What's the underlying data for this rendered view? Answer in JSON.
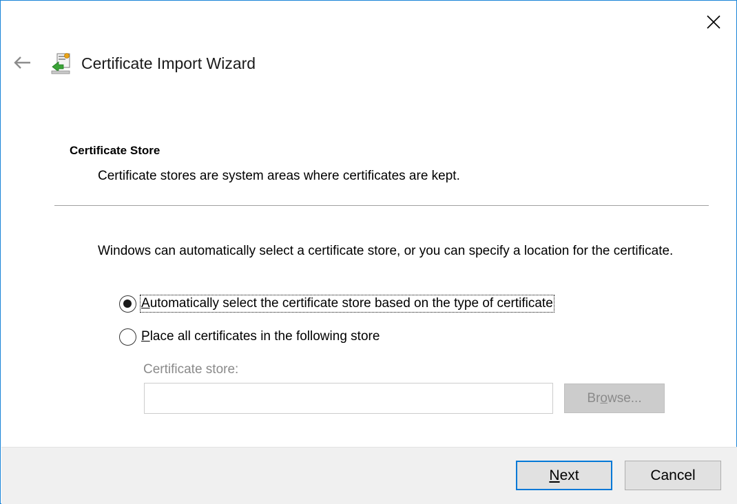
{
  "window": {
    "title": "Certificate Import Wizard",
    "accent_color": "#1883d7",
    "close_icon": "close-icon",
    "back_icon": "back-arrow-icon",
    "app_icon": "certificate-wizard-icon"
  },
  "header": {
    "section_title": "Certificate Store",
    "section_description": "Certificate stores are system areas where certificates are kept."
  },
  "body": {
    "intro": "Windows can automatically select a certificate store, or you can specify a location for the certificate.",
    "options": [
      {
        "label_mnemonic": "A",
        "label_rest": "utomatically select the certificate store based on the type of certificate",
        "selected": true
      },
      {
        "label_mnemonic": "P",
        "label_rest": "lace all certificates in the following store",
        "selected": false
      }
    ],
    "store_field": {
      "label": "Certificate store:",
      "value": ""
    },
    "browse_button": {
      "label_pre": "Br",
      "label_mnemonic": "o",
      "label_post": "wse...",
      "enabled": false
    }
  },
  "footer": {
    "next_mnemonic": "N",
    "next_rest": "ext",
    "cancel_label": "Cancel"
  }
}
